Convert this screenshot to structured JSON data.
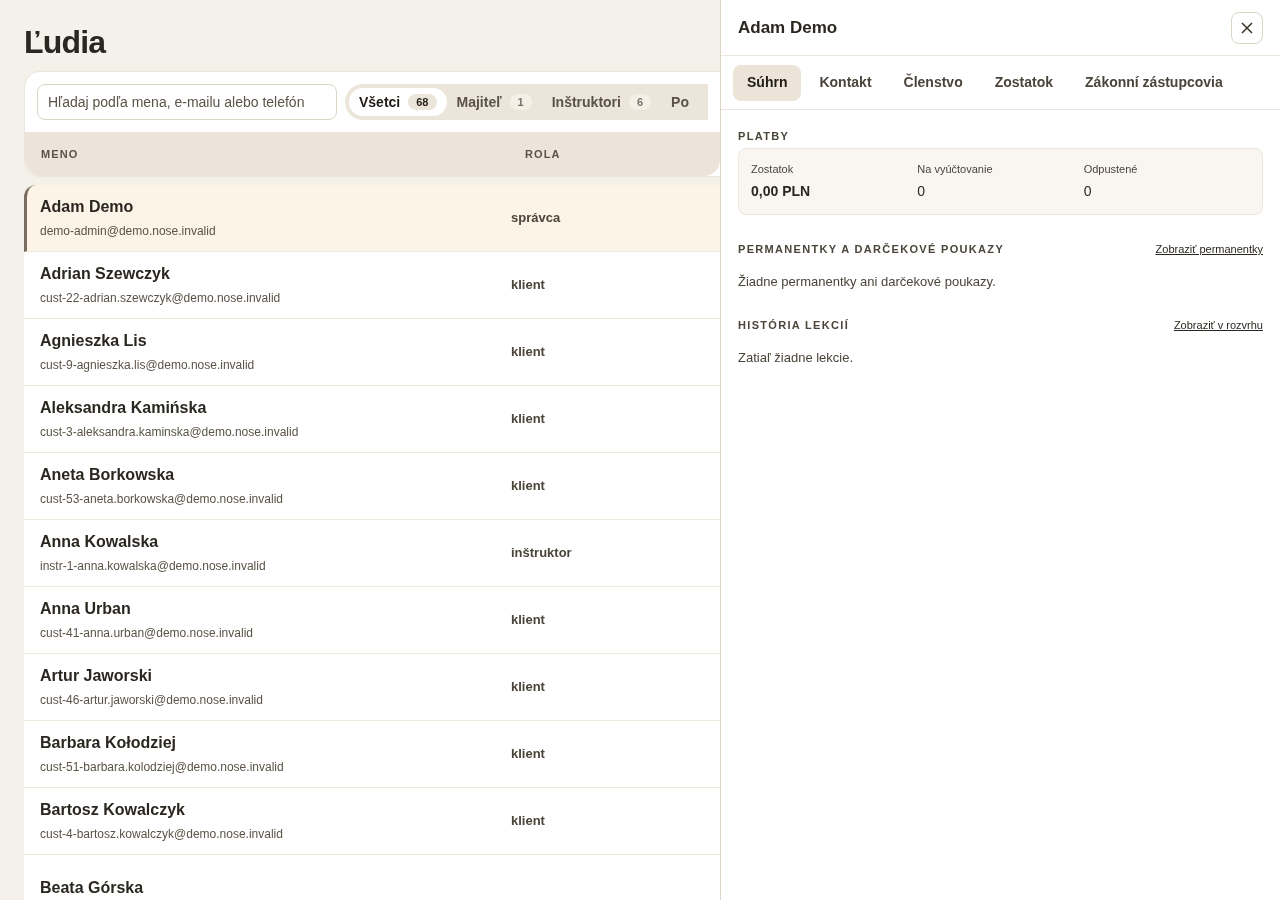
{
  "page_title": "Ľudia",
  "search": {
    "placeholder": "Hľadaj podľa mena, e-mailu alebo telefón"
  },
  "filters": [
    {
      "label": "Všetci",
      "count": "68",
      "selected": true
    },
    {
      "label": "Majiteľ",
      "count": "1",
      "selected": false
    },
    {
      "label": "Inštruktori",
      "count": "6",
      "selected": false
    },
    {
      "label": "Po",
      "selected": false
    }
  ],
  "table": {
    "columns": [
      "MENO",
      "ROLA"
    ],
    "rows": [
      {
        "name": "Adam Demo",
        "email": "demo-admin@demo.nose.invalid",
        "role": "správca",
        "selected": true
      },
      {
        "name": "Adrian Szewczyk",
        "email": "cust-22-adrian.szewczyk@demo.nose.invalid",
        "role": "klient",
        "selected": false
      },
      {
        "name": "Agnieszka Lis",
        "email": "cust-9-agnieszka.lis@demo.nose.invalid",
        "role": "klient",
        "selected": false
      },
      {
        "name": "Aleksandra Kamińska",
        "email": "cust-3-aleksandra.kaminska@demo.nose.invalid",
        "role": "klient",
        "selected": false
      },
      {
        "name": "Aneta Borkowska",
        "email": "cust-53-aneta.borkowska@demo.nose.invalid",
        "role": "klient",
        "selected": false
      },
      {
        "name": "Anna Kowalska",
        "email": "instr-1-anna.kowalska@demo.nose.invalid",
        "role": "inštruktor",
        "selected": false
      },
      {
        "name": "Anna Urban",
        "email": "cust-41-anna.urban@demo.nose.invalid",
        "role": "klient",
        "selected": false
      },
      {
        "name": "Artur Jaworski",
        "email": "cust-46-artur.jaworski@demo.nose.invalid",
        "role": "klient",
        "selected": false
      },
      {
        "name": "Barbara Kołodziej",
        "email": "cust-51-barbara.kolodziej@demo.nose.invalid",
        "role": "klient",
        "selected": false
      },
      {
        "name": "Bartosz Kowalczyk",
        "email": "cust-4-bartosz.kowalczyk@demo.nose.invalid",
        "role": "klient",
        "selected": false
      },
      {
        "name": "Beata Górska",
        "selected": false
      }
    ]
  },
  "panel": {
    "title": "Adam Demo",
    "tabs": [
      {
        "label": "Súhrn",
        "selected": true
      },
      {
        "label": "Kontakt",
        "selected": false
      },
      {
        "label": "Členstvo",
        "selected": false
      },
      {
        "label": "Zostatok",
        "selected": false
      },
      {
        "label": "Zákonní zástupcovia",
        "selected": false
      }
    ],
    "payments": {
      "heading": "PLATBY",
      "stats": [
        {
          "label": "Zostatok",
          "value": "0,00 PLN",
          "emphasis": true
        },
        {
          "label": "Na vyúčtovanie",
          "value": "0",
          "emphasis": false
        },
        {
          "label": "Odpustené",
          "value": "0",
          "emphasis": false
        }
      ]
    },
    "sections": [
      {
        "heading": "PERMANENTKY A DARČEKOVÉ POUKAZY",
        "link": "Zobraziť permanentky",
        "empty_text": "Žiadne permanentky ani darčekové poukazy."
      },
      {
        "heading": "HISTÓRIA LEKCIÍ",
        "link": "Zobraziť v rozvrhu",
        "empty_text": "Zatiaľ žiadne lekcie."
      }
    ]
  }
}
